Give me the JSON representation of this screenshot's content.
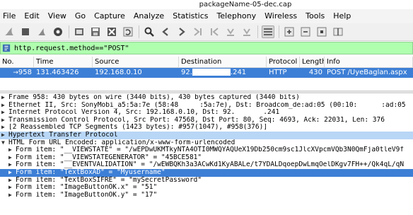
{
  "window": {
    "title": "packageName-05-dec.cap"
  },
  "menu": [
    "File",
    "Edit",
    "View",
    "Go",
    "Capture",
    "Analyze",
    "Statistics",
    "Telephony",
    "Wireless",
    "Tools",
    "Help"
  ],
  "toolbar": {
    "icons": [
      "shark-fin-icon",
      "stop-icon",
      "restart-icon",
      "options-gear-icon",
      "open-folder-icon",
      "save-icon",
      "close-file-icon",
      "reload-icon",
      "find-icon",
      "back-icon",
      "forward-icon",
      "go-to-packet-icon",
      "first-packet-icon",
      "last-packet-icon",
      "autoscroll-icon",
      "colorize-icon",
      "zoom-in-icon",
      "zoom-out-icon",
      "normal-size-icon",
      "resize-columns-icon"
    ]
  },
  "filter": {
    "value": "http.request.method==\"POST\""
  },
  "packet_list": {
    "columns": [
      "No.",
      "Time",
      "Source",
      "Destination",
      "Protocol",
      "Length",
      "Info"
    ],
    "rows": [
      {
        "no": "958",
        "time": "131.463426",
        "source": "192.168.0.10",
        "destination_prefix": "92.",
        "destination_suffix": ".241",
        "protocol": "HTTP",
        "length": "430",
        "info": "POST /UyeBaglan.aspx"
      }
    ]
  },
  "details": {
    "frame": "Frame 958: 430 bytes on wire (3440 bits), 430 bytes captured (3440 bits)",
    "ethernet_a": "Ethernet II, Src: SonyMobi_a5:5a:7e (58:48",
    "ethernet_b": ":5a:7e), Dst: Broadcom_de:ad:05 (00:10:",
    "ethernet_c": ":ad:05",
    "ip_a": "Internet Protocol Version 4, Src: 192.168.0.10, Dst: 92.",
    "ip_b": ".241",
    "tcp": "Transmission Control Protocol, Src Port: 47568, Dst Port: 80, Seq: 4693, Ack: 22031, Len: 376",
    "reassembled": "[2 Reassembled TCP Segments (1423 bytes): #957(1047), #958(376)]",
    "http": "Hypertext Transfer Protocol",
    "form": "HTML Form URL Encoded: application/x-www-form-urlencoded",
    "items": [
      "Form item: \"__VIEWSTATE\" = \"/wEPDwUKMTkyNTA4OTI0MWQYAQUeX19Db250cm9sc1JlcXVpcmVQb3N0QmFja0tleV9f",
      "Form item: \"__VIEWSTATEGENERATOR\" = \"45BCE581\"",
      "Form item: \"__EVENTVALIDATION\" = \"/wEWBQKh3a3ACwKd1KyABALe/t7YDALDqoepDwLmqOelDKgv7FH++/Qk4qL/qN",
      "Form item: \"TextBoxAD\" = \"Myusername\"",
      "Form item: \"TextBoxSIFRE\" = \"mySecretPassword\"",
      "Form item: \"ImageButtonOK.x\" = \"51\"",
      "Form item: \"ImageButtonOK.y\" = \"17\""
    ]
  }
}
